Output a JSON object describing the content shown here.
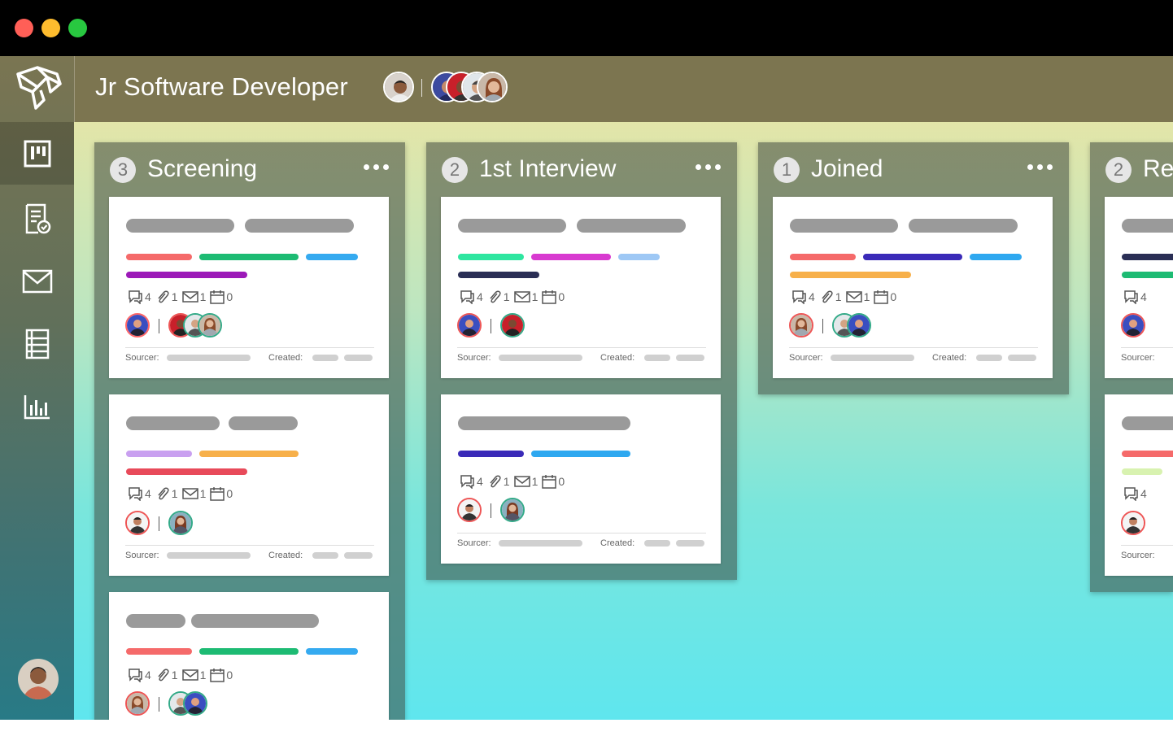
{
  "window": {
    "title_bar": "traffic-lights"
  },
  "header": {
    "title": "Jr Software Developer"
  },
  "sidebar": {
    "items": [
      {
        "name": "board",
        "icon": "board-icon"
      },
      {
        "name": "checklist",
        "icon": "document-check-icon"
      },
      {
        "name": "mail",
        "icon": "mail-icon"
      },
      {
        "name": "list",
        "icon": "list-icon"
      },
      {
        "name": "reports",
        "icon": "bar-chart-icon"
      }
    ]
  },
  "columns": [
    {
      "count": "3",
      "name": "Screening",
      "cards": [
        {
          "meta": {
            "comments": "4",
            "attachments": "1",
            "emails": "1",
            "events": "0"
          },
          "sourcer": "Sourcer:",
          "created": "Created:"
        },
        {
          "meta": {
            "comments": "4",
            "attachments": "1",
            "emails": "1",
            "events": "0"
          },
          "sourcer": "Sourcer:",
          "created": "Created:"
        },
        {
          "meta": {
            "comments": "4",
            "attachments": "1",
            "emails": "1",
            "events": "0"
          }
        }
      ]
    },
    {
      "count": "2",
      "name": "1st Interview",
      "cards": [
        {
          "meta": {
            "comments": "4",
            "attachments": "1",
            "emails": "1",
            "events": "0"
          },
          "sourcer": "Sourcer:",
          "created": "Created:"
        },
        {
          "meta": {
            "comments": "4",
            "attachments": "1",
            "emails": "1",
            "events": "0"
          },
          "sourcer": "Sourcer:",
          "created": "Created:"
        }
      ]
    },
    {
      "count": "1",
      "name": "Joined",
      "cards": [
        {
          "meta": {
            "comments": "4",
            "attachments": "1",
            "emails": "1",
            "events": "0"
          },
          "sourcer": "Sourcer:",
          "created": "Created:"
        }
      ]
    },
    {
      "count": "2",
      "name": "Re",
      "cards": [
        {
          "meta": {
            "comments": "4"
          },
          "sourcer": "Sourcer:"
        },
        {
          "meta": {
            "comments": "4"
          },
          "sourcer": "Sourcer:"
        }
      ]
    }
  ],
  "colors": {
    "header_bg": "#7c7550",
    "column_bg": "#5b6655",
    "card_bg": "#ffffff"
  }
}
